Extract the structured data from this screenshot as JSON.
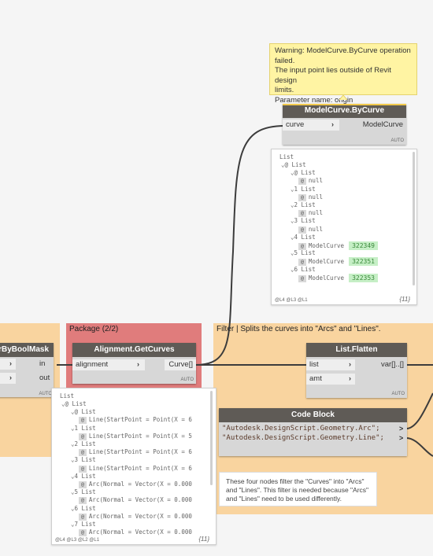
{
  "tooltip": {
    "lines": [
      "Warning: ModelCurve.ByCurve operation",
      "failed.",
      "The input point lies outside of Revit design",
      "limits.",
      "Parameter name: origin"
    ]
  },
  "model_curve_node": {
    "title": "ModelCurve.ByCurve",
    "input": "curve",
    "output": "ModelCurve",
    "lacing": "AUTO"
  },
  "model_curve_preview": {
    "root": "List",
    "lines": [
      {
        "text": "⌄@ List"
      },
      {
        "text": "⌄@ List"
      },
      {
        "idx": "@",
        "text": "null"
      },
      {
        "text": "⌄1 List"
      },
      {
        "idx": "@",
        "text": "null"
      },
      {
        "text": "⌄2 List"
      },
      {
        "idx": "@",
        "text": "null"
      },
      {
        "text": "⌄3 List"
      },
      {
        "idx": "@",
        "text": "null"
      },
      {
        "text": "⌄4 List"
      },
      {
        "idx": "@",
        "text": "ModelCurve",
        "badge": "322349"
      },
      {
        "text": "⌄5 List"
      },
      {
        "idx": "@",
        "text": "ModelCurve",
        "badge": "322351"
      },
      {
        "text": "⌄6 List"
      },
      {
        "idx": "@",
        "text": "ModelCurve",
        "badge": "322353"
      }
    ],
    "levels": "@L4 @L3 @L1",
    "count": "{11}"
  },
  "left_group": {
    "node_title": "rByBoolMask",
    "output_in": "in",
    "output_out": "out",
    "lacing": "AUTO"
  },
  "package_group": {
    "title": "Package (2/2)"
  },
  "get_curves_node": {
    "title": "Alignment.GetCurves",
    "input": "alignment",
    "output": "Curve[]",
    "lacing": "AUTO"
  },
  "get_curves_preview": {
    "root": "List",
    "lines": [
      {
        "text": "⌄@ List"
      },
      {
        "text": "⌄@ List"
      },
      {
        "idx": "@",
        "text": "Line(StartPoint = Point(X = 6"
      },
      {
        "text": "⌄1 List"
      },
      {
        "idx": "@",
        "text": "Line(StartPoint = Point(X = 5"
      },
      {
        "text": "⌄2 List"
      },
      {
        "idx": "@",
        "text": "Line(StartPoint = Point(X = 6"
      },
      {
        "text": "⌄3 List"
      },
      {
        "idx": "@",
        "text": "Line(StartPoint = Point(X = 6"
      },
      {
        "text": "⌄4 List"
      },
      {
        "idx": "@",
        "text": "Arc(Normal = Vector(X = 0.000"
      },
      {
        "text": "⌄5 List"
      },
      {
        "idx": "@",
        "text": "Arc(Normal = Vector(X = 0.000"
      },
      {
        "text": "⌄6 List"
      },
      {
        "idx": "@",
        "text": "Arc(Normal = Vector(X = 0.000"
      },
      {
        "text": "⌄7 List"
      },
      {
        "idx": "@",
        "text": "Arc(Normal = Vector(X = 0.000"
      }
    ],
    "levels": "@L4 @L3 @L2 @L1",
    "count": "{11}"
  },
  "filter_group": {
    "title": "Filter | Splits the curves into \"Arcs\" and \"Lines\"."
  },
  "flatten_node": {
    "title": "List.Flatten",
    "input_list": "list",
    "input_amt": "amt",
    "output": "var[]..[]",
    "lacing": "AUTO"
  },
  "code_block": {
    "title": "Code Block",
    "line1": "\"Autodesk.DesignScript.Geometry.Arc\";",
    "line2": "\"Autodesk.DesignScript.Geometry.Line\";"
  },
  "note": {
    "text": "These four nodes filter the \"Curves\" into \"Arcs\" and \"Lines\". This filter is needed because \"Arcs\" and \"Lines\" need to be used differently."
  },
  "colors": {
    "background": "#f5f5f5",
    "group_orange": "#f9d49f",
    "group_red": "#e07c7c",
    "node_header": "#5f5b56",
    "wire": "#3c3c3c",
    "tooltip": "#fff4a3",
    "badge_green": "#c6efc6"
  }
}
